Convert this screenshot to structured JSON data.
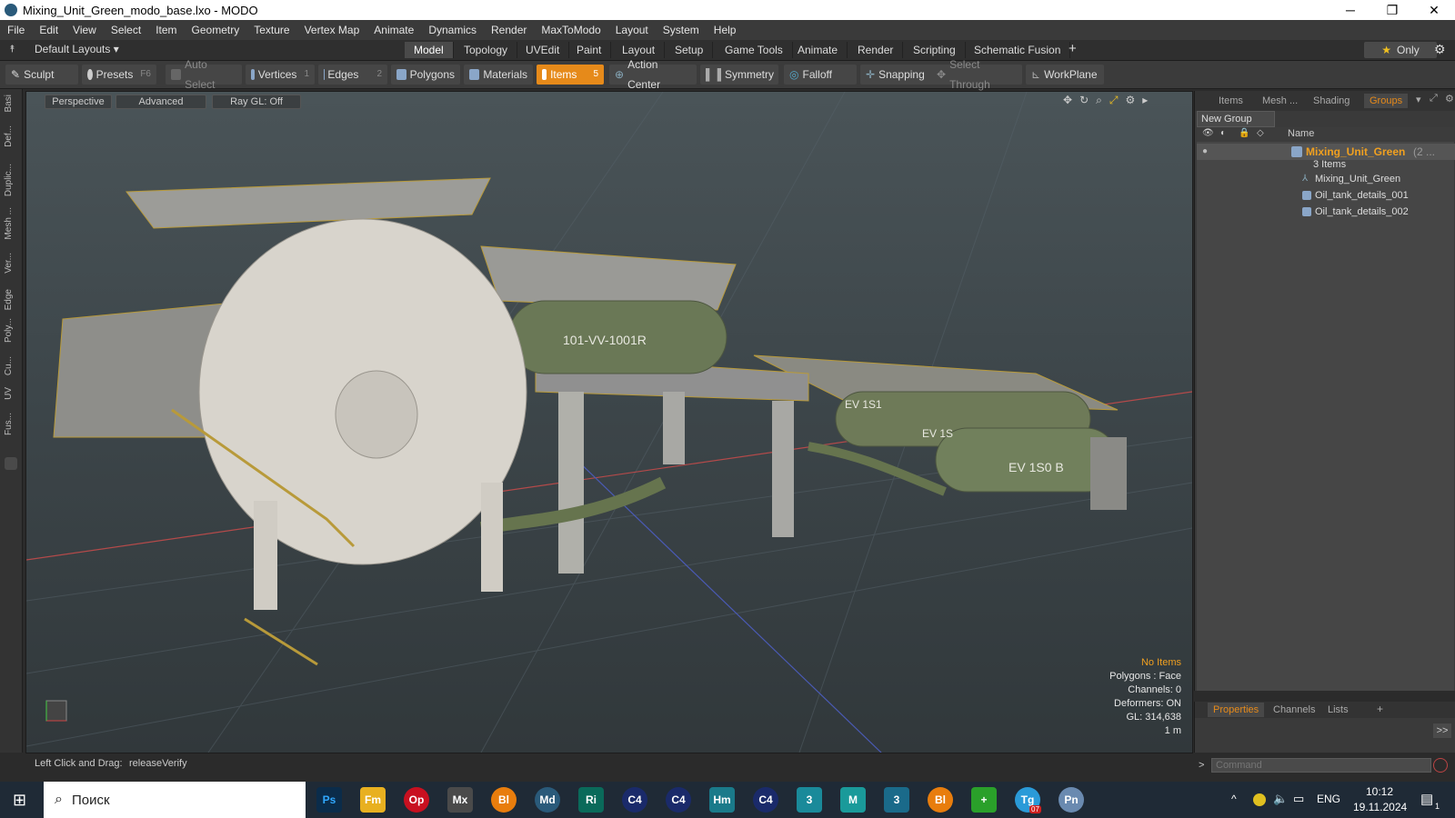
{
  "window": {
    "title": "Mixing_Unit_Green_modo_base.lxo - MODO",
    "controls": {
      "minimize": "─",
      "restore": "❐",
      "close": "✕"
    }
  },
  "menubar": [
    "File",
    "Edit",
    "View",
    "Select",
    "Item",
    "Geometry",
    "Texture",
    "Vertex Map",
    "Animate",
    "Dynamics",
    "Render",
    "MaxToModo",
    "Layout",
    "System",
    "Help"
  ],
  "layoutbar": {
    "layouts_label": "Default Layouts ▾",
    "tabs": [
      "Model",
      "Topology",
      "UVEdit",
      "Paint",
      "Layout",
      "Setup",
      "Game Tools",
      "Animate",
      "Render",
      "Scripting",
      "Schematic Fusion"
    ],
    "active_tab": "Model",
    "add": "+",
    "only_label": "Only"
  },
  "toolbar": {
    "sculpt": "Sculpt",
    "presets": "Presets",
    "presets_key": "F6",
    "auto_select": "Auto Select",
    "vertices": "Vertices",
    "vertices_count": "1",
    "edges": "Edges",
    "edges_count": "2",
    "polygons": "Polygons",
    "materials": "Materials",
    "items": "Items",
    "items_count": "5",
    "action_center": "Action Center",
    "symmetry": "Symmetry",
    "falloff": "Falloff",
    "snapping": "Snapping",
    "select_through": "Select Through",
    "workplane": "WorkPlane"
  },
  "leftstrip": [
    "Basi",
    "Def...",
    "Duplic...",
    "Mesh ...",
    "Ver...",
    "Edge",
    "Poly...",
    "Cu...",
    "UV",
    "Fus..."
  ],
  "viewport": {
    "perspective": "Perspective",
    "advanced": "Advanced",
    "raygl": "Ray GL: Off",
    "tank_label_1": "101-VV-1001R",
    "tank_label_2": "EV 1S1",
    "tank_label_3": "EV 1S",
    "tank_label_4": "EV 1S0 B",
    "hud": {
      "selection": "No Items",
      "polygons": "Polygons : Face",
      "channels": "Channels: 0",
      "deformers": "Deformers: ON",
      "gl": "GL: 314,638",
      "unit": "1 m"
    }
  },
  "rightpanel": {
    "tabs": [
      "Items",
      "Mesh ...",
      "Shading",
      "Groups"
    ],
    "active_tab": "Groups",
    "new_group": "New Group",
    "column_name": "Name",
    "group_name": "Mixing_Unit_Green",
    "group_suffix": "(2 ...",
    "group_count": "3 Items",
    "children": [
      "Mixing_Unit_Green",
      "Oil_tank_details_001",
      "Oil_tank_details_002"
    ]
  },
  "proppanel": {
    "tabs": [
      "Properties",
      "Channels",
      "Lists"
    ],
    "active_tab": "Properties",
    "add": "+",
    "expand": ">>",
    "command_placeholder": "Command",
    "prompt": ">"
  },
  "statusbar": {
    "hint_label": "Left Click and Drag:",
    "hint_value": "releaseVerify"
  },
  "taskbar": {
    "search_placeholder": "Поиск",
    "lang": "ENG",
    "time": "10:12",
    "date": "19.11.2024",
    "notif_count": "1",
    "telegram_badge": "07",
    "icons": [
      "Ps",
      "Fm",
      "Op",
      "Mx",
      "Bl",
      "Md",
      "Ri",
      "C4",
      "C4",
      "Hm",
      "C4",
      "3",
      "M",
      "3",
      "Bl",
      "+",
      "Tg",
      "Pn"
    ]
  },
  "colors": {
    "accent": "#e68a1a",
    "group_text": "#f0a020",
    "viewport_top": "#4a5458",
    "viewport_bottom": "#31383b"
  }
}
